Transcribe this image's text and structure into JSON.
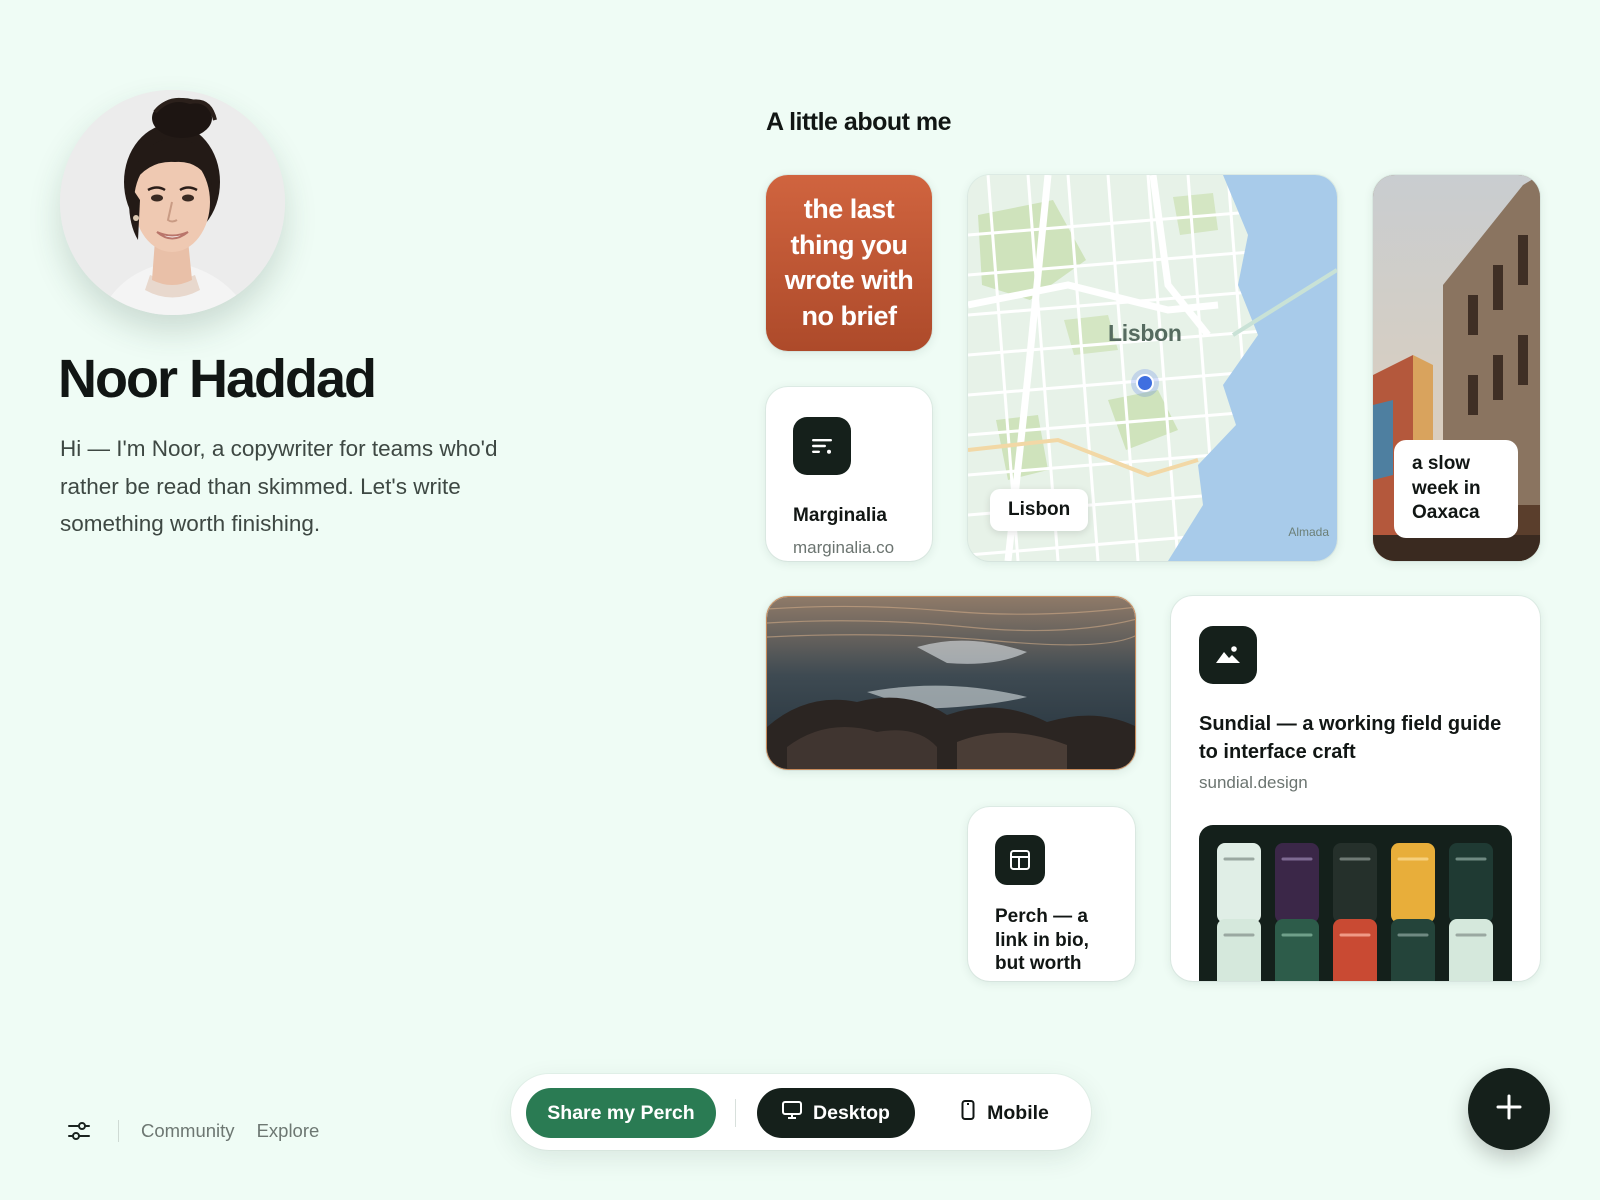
{
  "profile": {
    "name": "Noor Haddad",
    "bio": "Hi — I'm Noor, a copywriter for teams who'd rather be read than skimmed. Let's write something worth finishing."
  },
  "section": {
    "title": "A little about me"
  },
  "tiles": {
    "note": {
      "text": "the last thing you wrote with no brief",
      "color": "#c2573a"
    },
    "marginalia": {
      "title": "Marginalia",
      "url": "marginalia.co",
      "icon": "text-lines-icon"
    },
    "map": {
      "city": "Lisbon",
      "label": "Lisbon",
      "attribution": "Almada",
      "pin_color": "#3f6fe0"
    },
    "oaxaca": {
      "caption": "a slow week in Oaxaca"
    },
    "sea": {
      "alt_icon": "photo-sea-rocks"
    },
    "perch": {
      "title": "Perch — a link in bio, but worth",
      "icon": "layout-icon"
    },
    "sundial": {
      "title": "Sundial — a working field guide to interface craft",
      "url": "sundial.design",
      "icon": "image-icon"
    }
  },
  "footer": {
    "links": [
      "Community",
      "Explore"
    ],
    "settings_icon": "sliders-icon"
  },
  "toolbar": {
    "share_label": "Share my Perch",
    "desktop_label": "Desktop",
    "mobile_label": "Mobile",
    "active_view": "Desktop",
    "accent_color": "#2a7b53"
  },
  "fab": {
    "icon": "plus-icon"
  }
}
